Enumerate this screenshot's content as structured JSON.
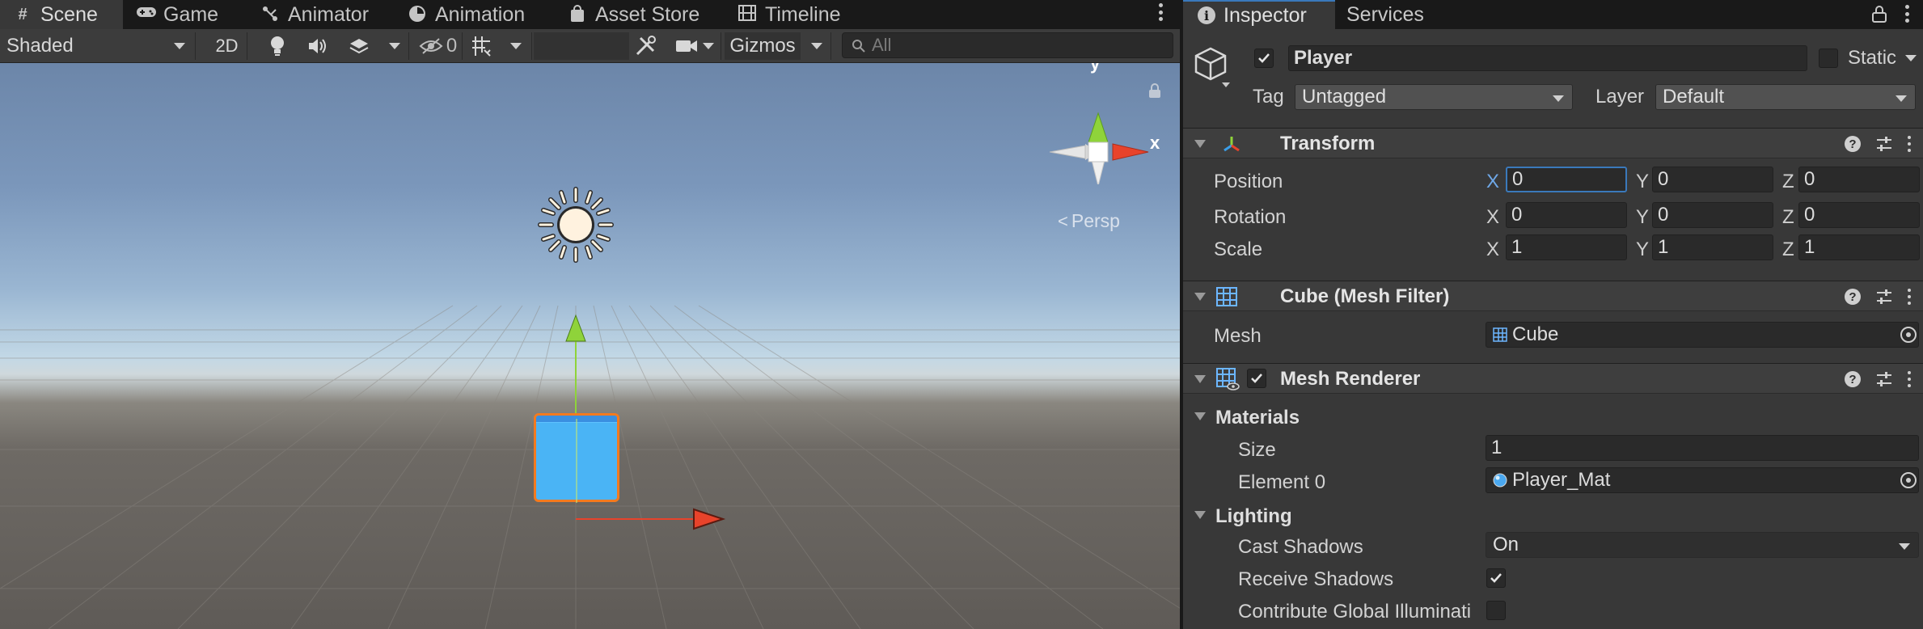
{
  "scene_tabs": [
    {
      "label": "Scene",
      "icon": "grid-hash-icon"
    },
    {
      "label": "Game",
      "icon": "gamepad-icon"
    },
    {
      "label": "Animator",
      "icon": "animator-graph-icon"
    },
    {
      "label": "Animation",
      "icon": "clock-icon"
    },
    {
      "label": "Asset Store",
      "icon": "shopping-bag-icon"
    },
    {
      "label": "Timeline",
      "icon": "film-strip-icon"
    }
  ],
  "scene_toolbar": {
    "draw_mode": "Shaded",
    "mode_2d": "2D",
    "hidden_count": "0",
    "gizmos": "Gizmos",
    "search_placeholder": "All"
  },
  "viewport": {
    "axis_y": "y",
    "axis_x": "x",
    "projection": "Persp"
  },
  "inspector_tabs": [
    {
      "label": "Inspector"
    },
    {
      "label": "Services"
    }
  ],
  "object": {
    "active": true,
    "name": "Player",
    "static_label": "Static",
    "static": false,
    "tag_label": "Tag",
    "tag": "Untagged",
    "layer_label": "Layer",
    "layer": "Default"
  },
  "transform": {
    "title": "Transform",
    "rows": [
      {
        "label": "Position",
        "x": "0",
        "y": "0",
        "z": "0"
      },
      {
        "label": "Rotation",
        "x": "0",
        "y": "0",
        "z": "0"
      },
      {
        "label": "Scale",
        "x": "1",
        "y": "1",
        "z": "1"
      }
    ],
    "axes": [
      "X",
      "Y",
      "Z"
    ]
  },
  "mesh_filter": {
    "title": "Cube (Mesh Filter)",
    "mesh_label": "Mesh",
    "mesh_value": "Cube"
  },
  "mesh_renderer": {
    "title": "Mesh Renderer",
    "enabled": true,
    "materials_label": "Materials",
    "size_label": "Size",
    "size_value": "1",
    "element0_label": "Element 0",
    "element0_value": "Player_Mat",
    "lighting_label": "Lighting",
    "cast_shadows_label": "Cast Shadows",
    "cast_shadows_value": "On",
    "receive_shadows_label": "Receive Shadows",
    "receive_shadows": true,
    "contribute_gi_label": "Contribute Global Illuminati",
    "contribute_gi": false
  },
  "colors": {
    "selection_outline": "#f37a1f",
    "cube": "#4ab4f5",
    "axis_x": "#e8432b",
    "axis_y": "#8fd33a",
    "focus_blue": "#3a79bb"
  }
}
